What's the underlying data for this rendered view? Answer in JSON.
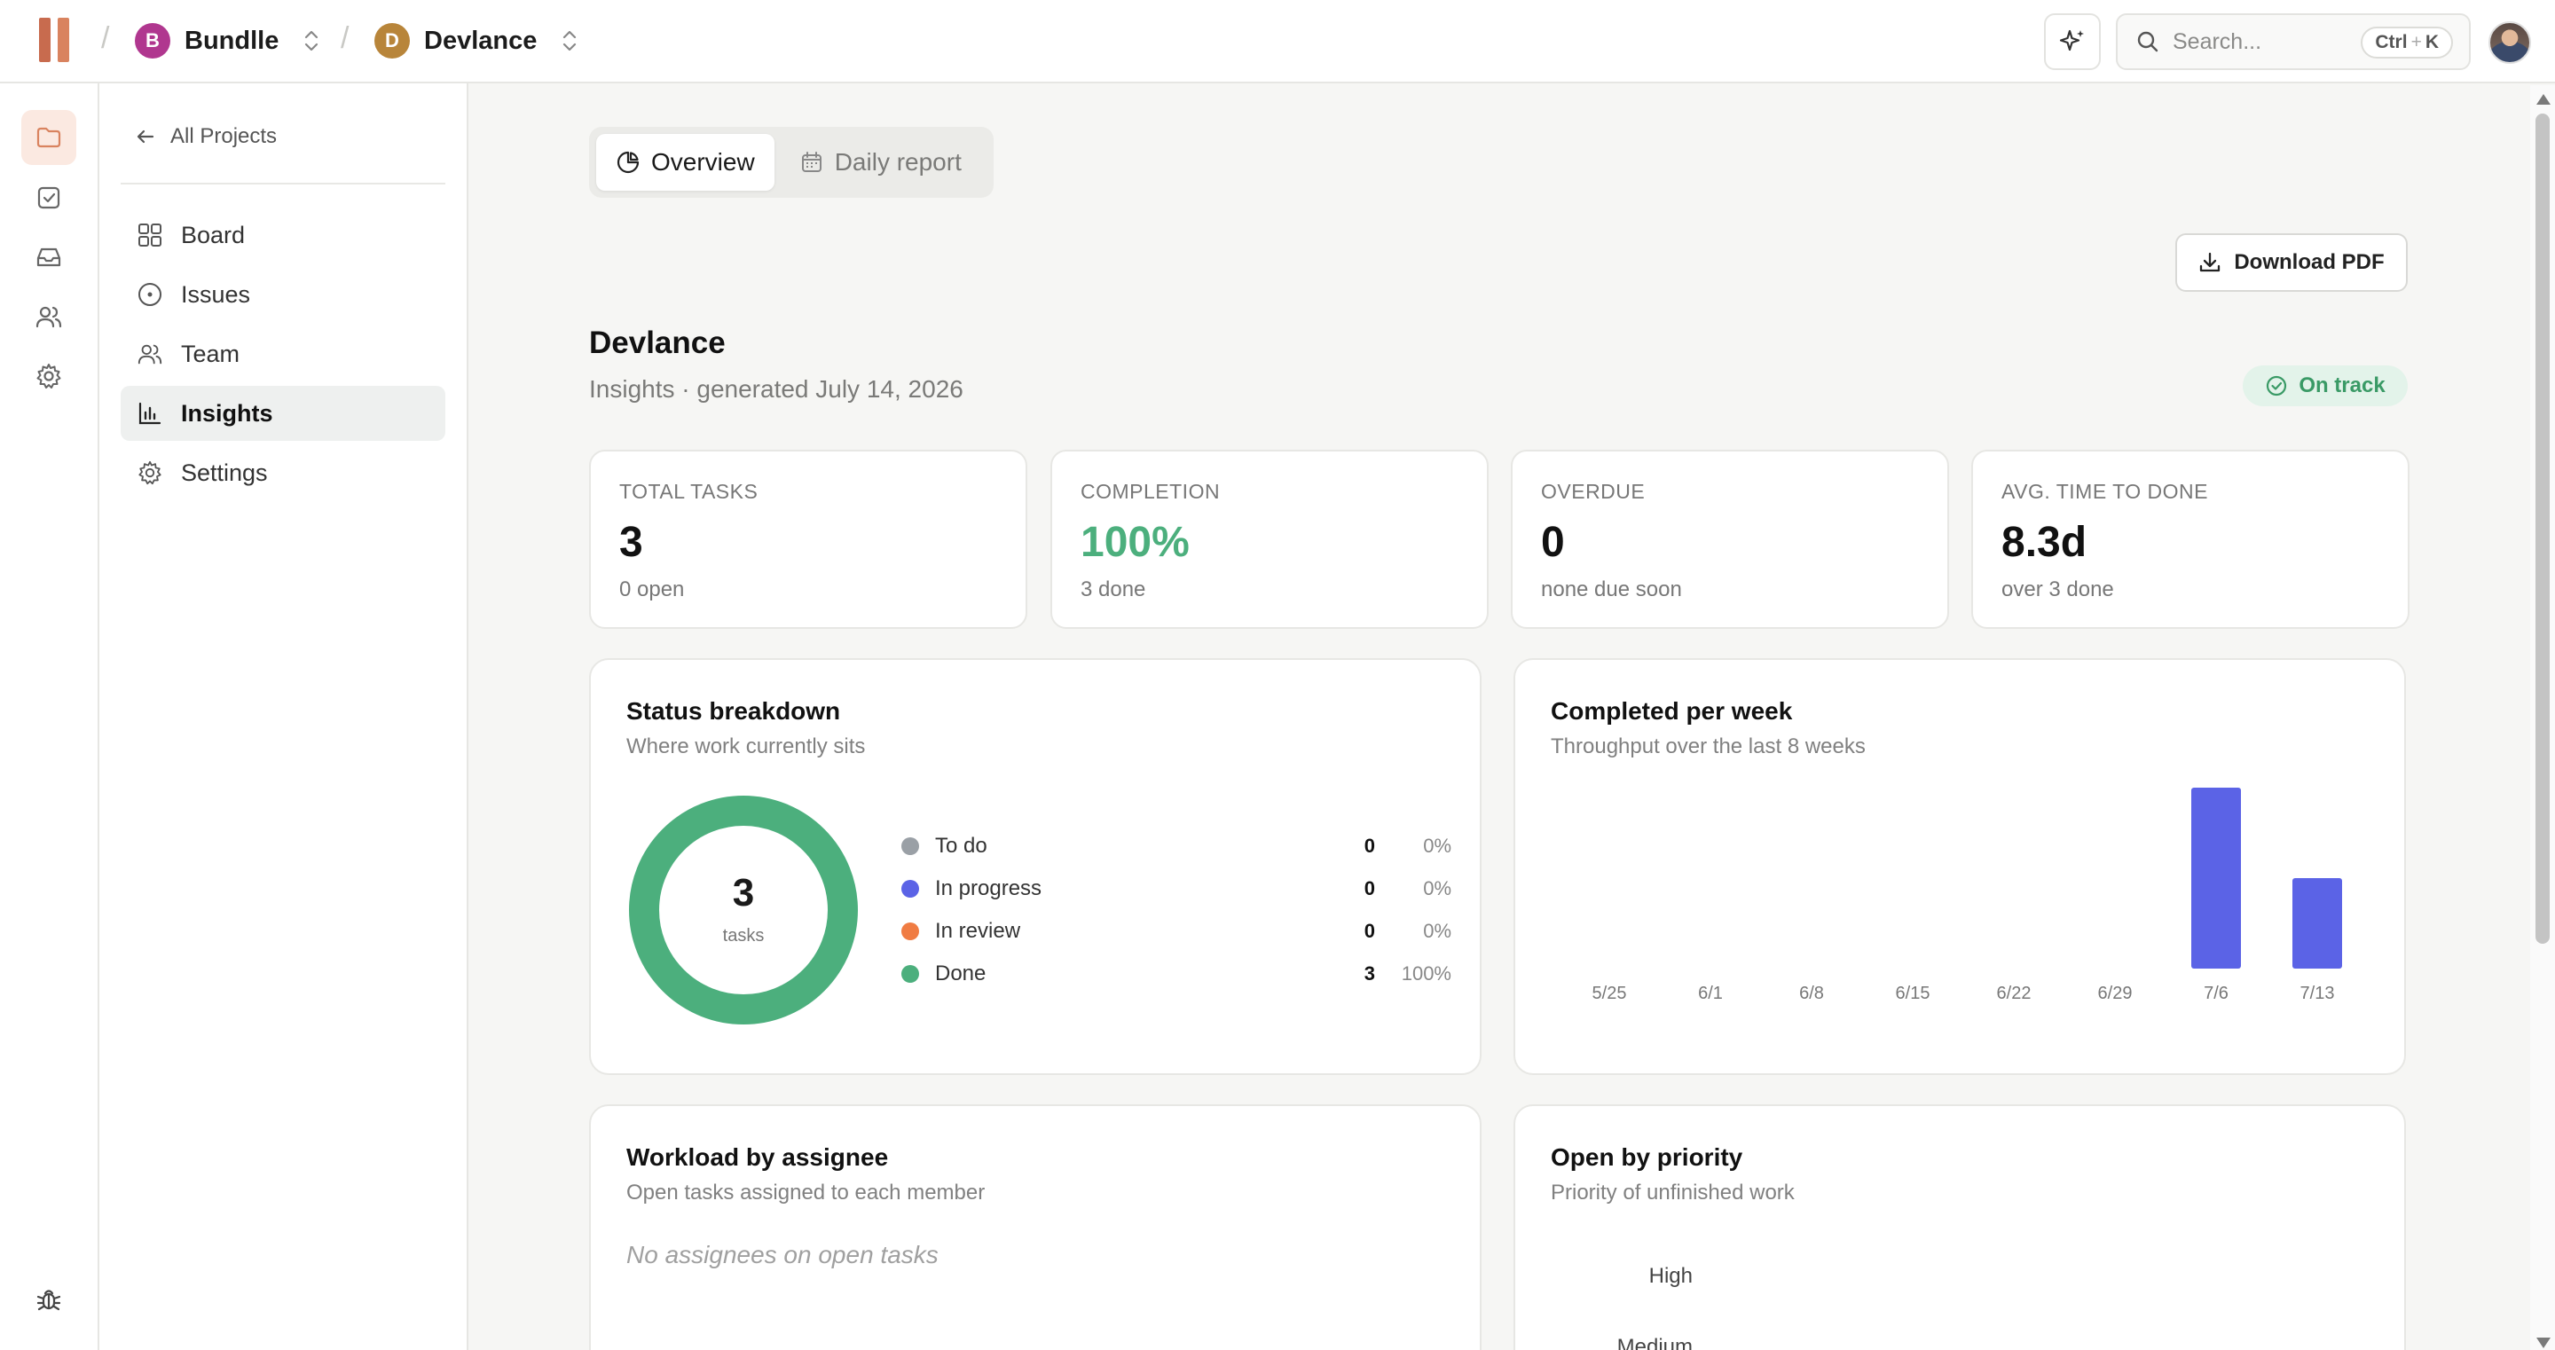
{
  "topbar": {
    "workspace": {
      "initial": "B",
      "name": "Bundlle",
      "color": "#b0378f"
    },
    "project": {
      "initial": "D",
      "name": "Devlance",
      "color": "#b8853a"
    },
    "search": {
      "placeholder": "Search...",
      "shortcut_ctrl": "Ctrl",
      "shortcut_plus": "+",
      "shortcut_key": "K"
    }
  },
  "rail": {
    "items": [
      {
        "icon": "folder-icon",
        "active": true
      },
      {
        "icon": "check-square-icon",
        "active": false
      },
      {
        "icon": "inbox-icon",
        "active": false
      },
      {
        "icon": "users-icon",
        "active": false
      },
      {
        "icon": "gear-icon",
        "active": false
      }
    ],
    "bottom_icon": "bug-icon"
  },
  "sidebar": {
    "back_label": "All Projects",
    "items": [
      {
        "label": "Board",
        "icon": "grid-icon"
      },
      {
        "label": "Issues",
        "icon": "circle-dot-icon"
      },
      {
        "label": "Team",
        "icon": "users-icon"
      },
      {
        "label": "Insights",
        "icon": "bar-chart-icon",
        "active": true
      },
      {
        "label": "Settings",
        "icon": "gear-icon"
      }
    ]
  },
  "tabs": [
    {
      "label": "Overview",
      "icon": "pie-icon",
      "active": true
    },
    {
      "label": "Daily report",
      "icon": "calendar-icon",
      "active": false
    }
  ],
  "actions": {
    "download_pdf": "Download PDF"
  },
  "project": {
    "title": "Devlance",
    "subtitle": "Insights · generated July 14, 2026",
    "status": "On track",
    "status_color": "#3a9a66"
  },
  "stats": [
    {
      "label": "TOTAL TASKS",
      "value": "3",
      "hint": "0 open"
    },
    {
      "label": "COMPLETION",
      "value": "100%",
      "hint": "3 done",
      "accent": "#4caf7d"
    },
    {
      "label": "OVERDUE",
      "value": "0",
      "hint": "none due soon"
    },
    {
      "label": "AVG. TIME TO DONE",
      "value": "8.3d",
      "hint": "over 3 done"
    }
  ],
  "status_breakdown": {
    "title": "Status breakdown",
    "subtitle": "Where work currently sits",
    "total": "3",
    "total_label": "tasks",
    "rows": [
      {
        "label": "To do",
        "count": "0",
        "pct": "0%",
        "color": "#9aa0a6"
      },
      {
        "label": "In progress",
        "count": "0",
        "pct": "0%",
        "color": "#5b63e6"
      },
      {
        "label": "In review",
        "count": "0",
        "pct": "0%",
        "color": "#f07c43"
      },
      {
        "label": "Done",
        "count": "3",
        "pct": "100%",
        "color": "#4caf7d"
      }
    ]
  },
  "completed_per_week": {
    "title": "Completed per week",
    "subtitle": "Throughput over the last 8 weeks"
  },
  "chart_data": {
    "type": "bar",
    "categories": [
      "5/25",
      "6/1",
      "6/8",
      "6/15",
      "6/22",
      "6/29",
      "7/6",
      "7/13"
    ],
    "values": [
      0,
      0,
      0,
      0,
      0,
      0,
      2,
      1
    ],
    "ylim": [
      0,
      2
    ],
    "color": "#5b63e6",
    "grid": false
  },
  "workload": {
    "title": "Workload by assignee",
    "subtitle": "Open tasks assigned to each member",
    "empty": "No assignees on open tasks"
  },
  "priority": {
    "title": "Open by priority",
    "subtitle": "Priority of unfinished work",
    "levels": [
      "High",
      "Medium"
    ]
  }
}
